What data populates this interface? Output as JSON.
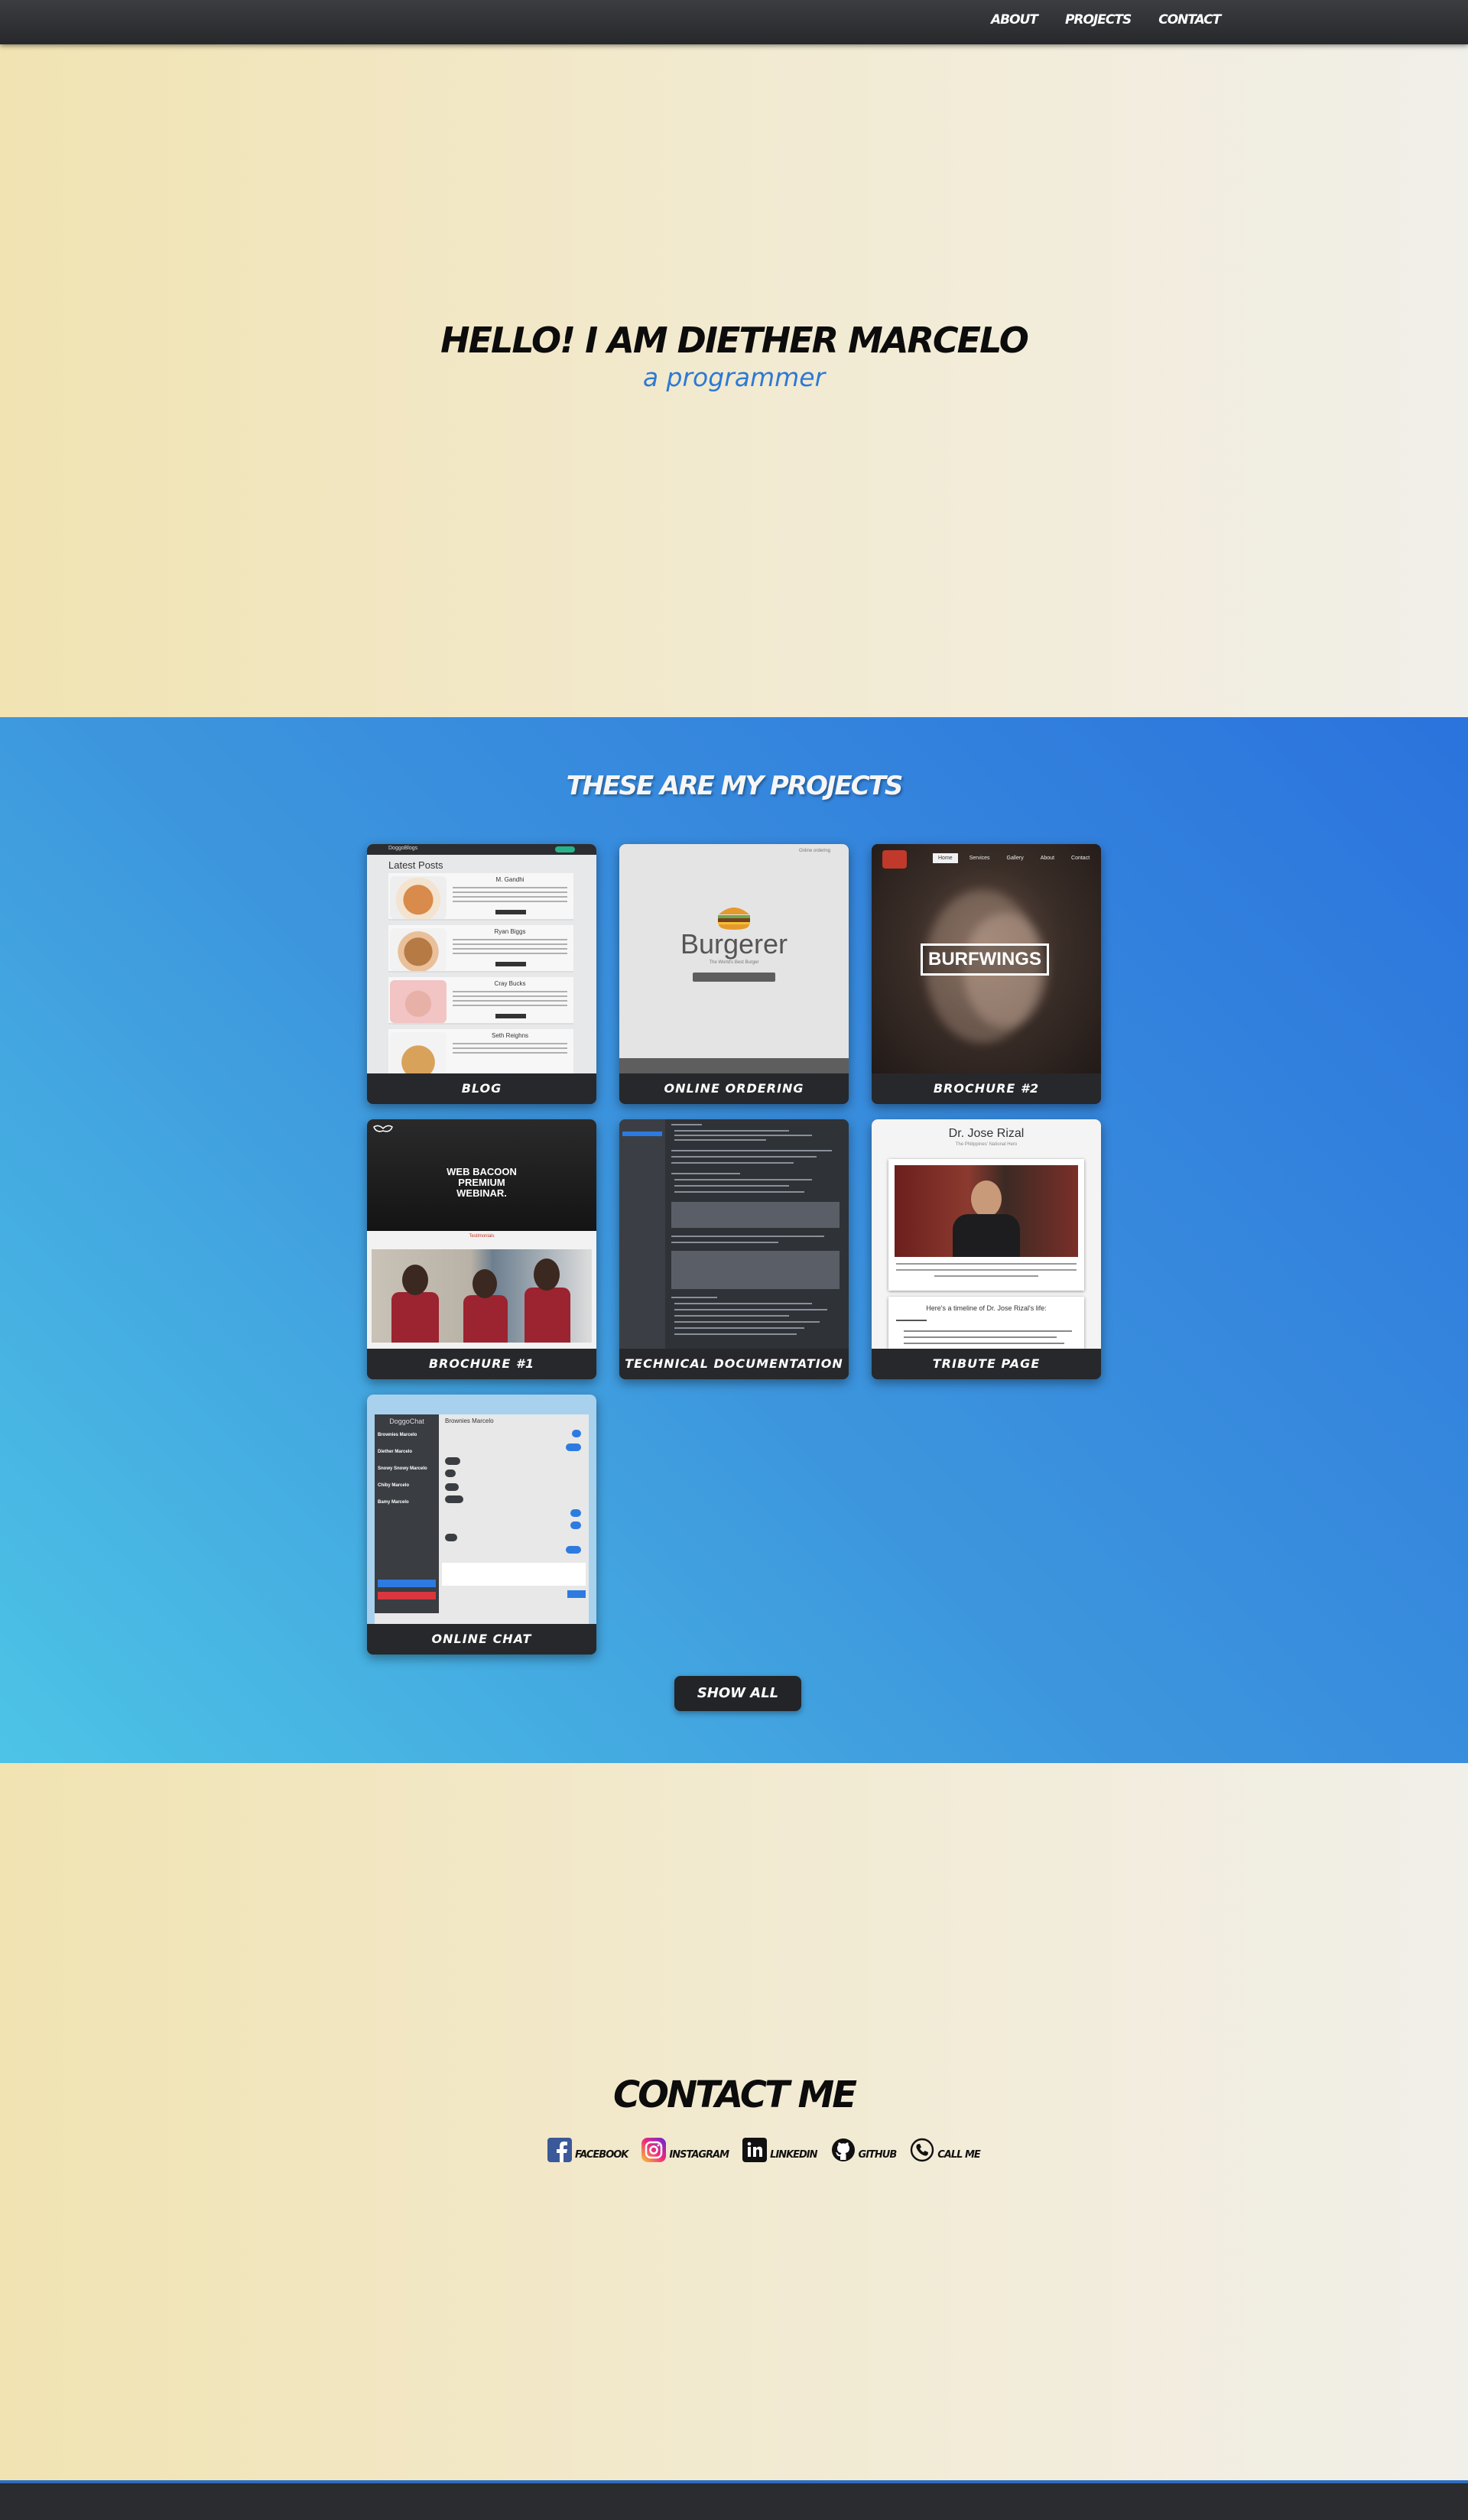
{
  "nav": {
    "items": [
      "ABOUT",
      "PROJECTS",
      "CONTACT"
    ]
  },
  "hero": {
    "title": "HELLO! I AM DIETHER MARCELO",
    "subtitle": "a programmer"
  },
  "projects": {
    "title": "THESE ARE MY PROJECTS",
    "cards": [
      {
        "label": "BLOG"
      },
      {
        "label": "ONLINE ORDERING"
      },
      {
        "label": "BROCHURE #2"
      },
      {
        "label": "BROCHURE #1"
      },
      {
        "label": "TECHNICAL DOCUMENTATION"
      },
      {
        "label": "TRIBUTE PAGE"
      },
      {
        "label": "ONLINE CHAT"
      }
    ],
    "show_all": "SHOW ALL",
    "thumb_text": {
      "blog_heading": "Latest Posts",
      "blog_posts": [
        "M. Gandhi",
        "Ryan Biggs",
        "Cray Bucks",
        "Seth Reighns"
      ],
      "order_brand": "Burgerer",
      "brochure2_brand": "BURFWINGS",
      "brochure2_menu": [
        "Home",
        "Services",
        "Gallery",
        "About",
        "Contact"
      ],
      "brochure1_heading": "WEB BACOON PREMIUM WEBINAR.",
      "tribute_name": "Dr. Jose Rizal",
      "tribute_timeline": "Here's a timeline of Dr. Jose Rizal's life:",
      "chat_title": "DoggoChat",
      "chat_header": "Brownies Marcelo",
      "chat_users": [
        "Brownies Marcelo",
        "Diether Marcelo",
        "Snowy Snowy Marcelo",
        "Chiby Marcelo",
        "Bamy Marcelo"
      ]
    }
  },
  "contact": {
    "title": "CONTACT ME",
    "links": [
      "FACEBOOK",
      "INSTAGRAM",
      "LINKEDIN",
      "GITHUB",
      "CALL ME"
    ]
  },
  "colors": {
    "accent_blue": "#2d79d6",
    "card_dark": "#27282b",
    "dark_nav": "#2a2c2f"
  }
}
